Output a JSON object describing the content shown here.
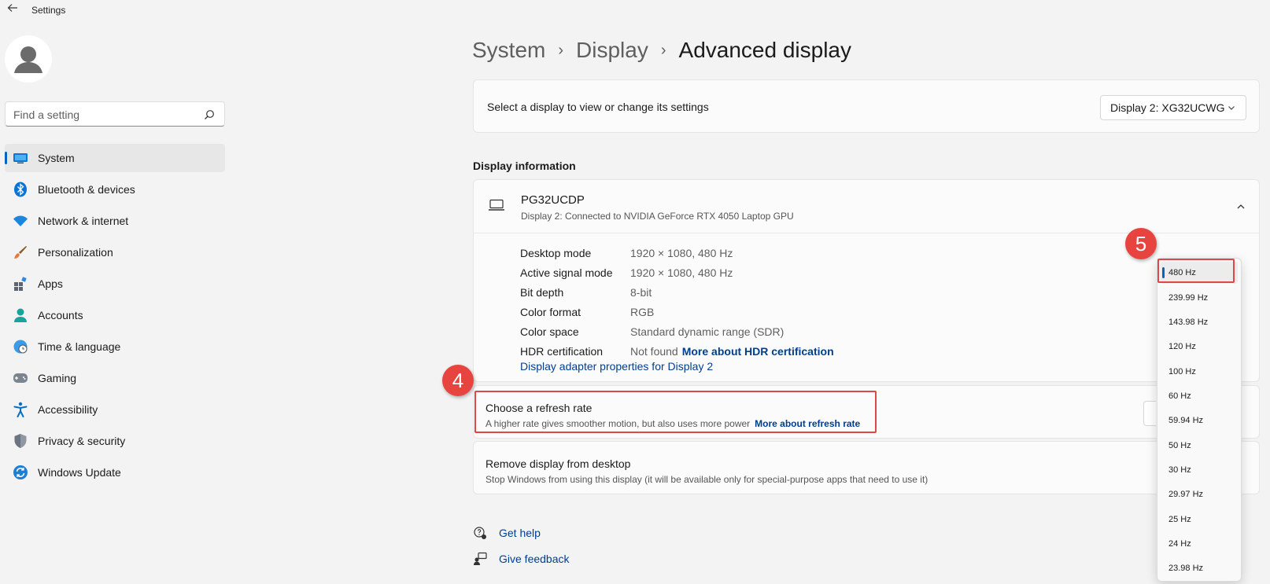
{
  "window": {
    "title": "Settings"
  },
  "search": {
    "placeholder": "Find a setting"
  },
  "sidebar": {
    "items": [
      {
        "label": "System",
        "icon": "system-icon",
        "active": true
      },
      {
        "label": "Bluetooth & devices",
        "icon": "bluetooth-icon"
      },
      {
        "label": "Network & internet",
        "icon": "wifi-icon"
      },
      {
        "label": "Personalization",
        "icon": "brush-icon"
      },
      {
        "label": "Apps",
        "icon": "apps-icon"
      },
      {
        "label": "Accounts",
        "icon": "accounts-icon"
      },
      {
        "label": "Time & language",
        "icon": "clock-globe-icon"
      },
      {
        "label": "Gaming",
        "icon": "gamepad-icon"
      },
      {
        "label": "Accessibility",
        "icon": "accessibility-icon"
      },
      {
        "label": "Privacy & security",
        "icon": "shield-icon"
      },
      {
        "label": "Windows Update",
        "icon": "update-icon"
      }
    ]
  },
  "breadcrumb": {
    "level1": "System",
    "level2": "Display",
    "current": "Advanced display",
    "separator": "›"
  },
  "display_select": {
    "label": "Select a display to view or change its settings",
    "value": "Display 2: XG32UCWG"
  },
  "display_info": {
    "section_title": "Display information",
    "monitor_name": "PG32UCDP",
    "monitor_sub": "Display 2: Connected to NVIDIA GeForce RTX 4050 Laptop GPU",
    "rows": [
      {
        "key": "Desktop mode",
        "value": "1920 × 1080, 480 Hz"
      },
      {
        "key": "Active signal mode",
        "value": "1920 × 1080, 480 Hz"
      },
      {
        "key": "Bit depth",
        "value": "8-bit"
      },
      {
        "key": "Color format",
        "value": "RGB"
      },
      {
        "key": "Color space",
        "value": "Standard dynamic range (SDR)"
      },
      {
        "key": "HDR certification",
        "value": "Not found",
        "link": "More about HDR certification"
      }
    ],
    "adapter_link": "Display adapter properties for Display 2"
  },
  "refresh_rate": {
    "title": "Choose a refresh rate",
    "subtitle": "A higher rate gives smoother motion, but also uses more power",
    "link": "More about refresh rate",
    "options": [
      "480 Hz",
      "239.99 Hz",
      "143.98 Hz",
      "120 Hz",
      "100 Hz",
      "60 Hz",
      "59.94 Hz",
      "50 Hz",
      "30 Hz",
      "29.97 Hz",
      "25 Hz",
      "24 Hz",
      "23.98 Hz"
    ],
    "selected": "480 Hz"
  },
  "remove_display": {
    "title": "Remove display from desktop",
    "subtitle": "Stop Windows from using this display (it will be available only for special-purpose apps that need to use it)"
  },
  "help": {
    "get_help": "Get help",
    "give_feedback": "Give feedback"
  },
  "annotations": {
    "step4": "4",
    "step5": "5",
    "color": "#e8443f"
  },
  "colors": {
    "accent": "#0067c0",
    "link": "#003e92",
    "background": "#f3f3f3"
  }
}
